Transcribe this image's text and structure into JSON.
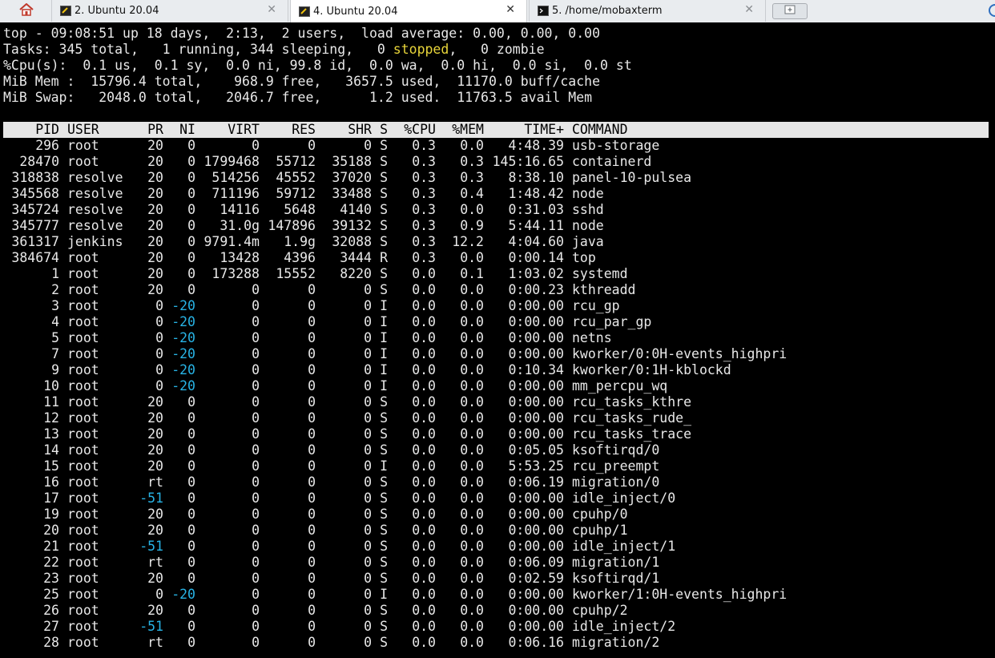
{
  "tabs": {
    "home_icon": "home-icon",
    "items": [
      {
        "label": "2. Ubuntu 20.04",
        "icon": "ssh-session-icon",
        "close": "✕"
      },
      {
        "label": "4. Ubuntu 20.04",
        "icon": "ssh-session-icon",
        "close": "✕"
      },
      {
        "label": "5. /home/mobaxterm",
        "icon": "terminal-icon",
        "close": "✕"
      }
    ],
    "new_tab_icon": "new-tab-icon"
  },
  "summary": {
    "line1": "top - 09:08:51 up 18 days,  2:13,  2 users,  load average: 0.00, 0.00, 0.00",
    "line2_pre": "Tasks: 345 total,   1 running, 344 sleeping,   0 ",
    "line2_stopped": "stopped",
    "line2_post": ",   0 zombie",
    "line3": "%Cpu(s):  0.1 us,  0.1 sy,  0.0 ni, 99.8 id,  0.0 wa,  0.0 hi,  0.0 si,  0.0 st",
    "line4": "MiB Mem :  15796.4 total,    968.9 free,   3657.5 used,  11170.0 buff/cache",
    "line5": "MiB Swap:   2048.0 total,   2046.7 free,      1.2 used.  11763.5 avail Mem"
  },
  "columns": [
    "PID",
    "USER",
    "PR",
    "NI",
    "VIRT",
    "RES",
    "SHR",
    "S",
    "%CPU",
    "%MEM",
    "TIME+",
    "COMMAND"
  ],
  "processes": [
    [
      "296",
      "root",
      "20",
      "0",
      "0",
      "0",
      "0",
      "S",
      "0.3",
      "0.0",
      "4:48.39",
      "usb-storage"
    ],
    [
      "28470",
      "root",
      "20",
      "0",
      "1799468",
      "55712",
      "35188",
      "S",
      "0.3",
      "0.3",
      "145:16.65",
      "containerd"
    ],
    [
      "318838",
      "resolve",
      "20",
      "0",
      "514256",
      "45552",
      "37020",
      "S",
      "0.3",
      "0.3",
      "8:38.10",
      "panel-10-pulsea"
    ],
    [
      "345568",
      "resolve",
      "20",
      "0",
      "711196",
      "59712",
      "33488",
      "S",
      "0.3",
      "0.4",
      "1:48.42",
      "node"
    ],
    [
      "345724",
      "resolve",
      "20",
      "0",
      "14116",
      "5648",
      "4140",
      "S",
      "0.3",
      "0.0",
      "0:31.03",
      "sshd"
    ],
    [
      "345777",
      "resolve",
      "20",
      "0",
      "31.0g",
      "147896",
      "39132",
      "S",
      "0.3",
      "0.9",
      "5:44.11",
      "node"
    ],
    [
      "361317",
      "jenkins",
      "20",
      "0",
      "9791.4m",
      "1.9g",
      "32088",
      "S",
      "0.3",
      "12.2",
      "4:04.60",
      "java"
    ],
    [
      "384674",
      "root",
      "20",
      "0",
      "13428",
      "4396",
      "3444",
      "R",
      "0.3",
      "0.0",
      "0:00.14",
      "top"
    ],
    [
      "1",
      "root",
      "20",
      "0",
      "173288",
      "15552",
      "8220",
      "S",
      "0.0",
      "0.1",
      "1:03.02",
      "systemd"
    ],
    [
      "2",
      "root",
      "20",
      "0",
      "0",
      "0",
      "0",
      "S",
      "0.0",
      "0.0",
      "0:00.23",
      "kthreadd"
    ],
    [
      "3",
      "root",
      "0",
      "-20",
      "0",
      "0",
      "0",
      "I",
      "0.0",
      "0.0",
      "0:00.00",
      "rcu_gp"
    ],
    [
      "4",
      "root",
      "0",
      "-20",
      "0",
      "0",
      "0",
      "I",
      "0.0",
      "0.0",
      "0:00.00",
      "rcu_par_gp"
    ],
    [
      "5",
      "root",
      "0",
      "-20",
      "0",
      "0",
      "0",
      "I",
      "0.0",
      "0.0",
      "0:00.00",
      "netns"
    ],
    [
      "7",
      "root",
      "0",
      "-20",
      "0",
      "0",
      "0",
      "I",
      "0.0",
      "0.0",
      "0:00.00",
      "kworker/0:0H-events_highpri"
    ],
    [
      "9",
      "root",
      "0",
      "-20",
      "0",
      "0",
      "0",
      "I",
      "0.0",
      "0.0",
      "0:10.34",
      "kworker/0:1H-kblockd"
    ],
    [
      "10",
      "root",
      "0",
      "-20",
      "0",
      "0",
      "0",
      "I",
      "0.0",
      "0.0",
      "0:00.00",
      "mm_percpu_wq"
    ],
    [
      "11",
      "root",
      "20",
      "0",
      "0",
      "0",
      "0",
      "S",
      "0.0",
      "0.0",
      "0:00.00",
      "rcu_tasks_kthre"
    ],
    [
      "12",
      "root",
      "20",
      "0",
      "0",
      "0",
      "0",
      "S",
      "0.0",
      "0.0",
      "0:00.00",
      "rcu_tasks_rude_"
    ],
    [
      "13",
      "root",
      "20",
      "0",
      "0",
      "0",
      "0",
      "S",
      "0.0",
      "0.0",
      "0:00.00",
      "rcu_tasks_trace"
    ],
    [
      "14",
      "root",
      "20",
      "0",
      "0",
      "0",
      "0",
      "S",
      "0.0",
      "0.0",
      "0:05.05",
      "ksoftirqd/0"
    ],
    [
      "15",
      "root",
      "20",
      "0",
      "0",
      "0",
      "0",
      "I",
      "0.0",
      "0.0",
      "5:53.25",
      "rcu_preempt"
    ],
    [
      "16",
      "root",
      "rt",
      "0",
      "0",
      "0",
      "0",
      "S",
      "0.0",
      "0.0",
      "0:06.19",
      "migration/0"
    ],
    [
      "17",
      "root",
      "-51",
      "0",
      "0",
      "0",
      "0",
      "S",
      "0.0",
      "0.0",
      "0:00.00",
      "idle_inject/0"
    ],
    [
      "19",
      "root",
      "20",
      "0",
      "0",
      "0",
      "0",
      "S",
      "0.0",
      "0.0",
      "0:00.00",
      "cpuhp/0"
    ],
    [
      "20",
      "root",
      "20",
      "0",
      "0",
      "0",
      "0",
      "S",
      "0.0",
      "0.0",
      "0:00.00",
      "cpuhp/1"
    ],
    [
      "21",
      "root",
      "-51",
      "0",
      "0",
      "0",
      "0",
      "S",
      "0.0",
      "0.0",
      "0:00.00",
      "idle_inject/1"
    ],
    [
      "22",
      "root",
      "rt",
      "0",
      "0",
      "0",
      "0",
      "S",
      "0.0",
      "0.0",
      "0:06.09",
      "migration/1"
    ],
    [
      "23",
      "root",
      "20",
      "0",
      "0",
      "0",
      "0",
      "S",
      "0.0",
      "0.0",
      "0:02.59",
      "ksoftirqd/1"
    ],
    [
      "25",
      "root",
      "0",
      "-20",
      "0",
      "0",
      "0",
      "I",
      "0.0",
      "0.0",
      "0:00.00",
      "kworker/1:0H-events_highpri"
    ],
    [
      "26",
      "root",
      "20",
      "0",
      "0",
      "0",
      "0",
      "S",
      "0.0",
      "0.0",
      "0:00.00",
      "cpuhp/2"
    ],
    [
      "27",
      "root",
      "-51",
      "0",
      "0",
      "0",
      "0",
      "S",
      "0.0",
      "0.0",
      "0:00.00",
      "idle_inject/2"
    ],
    [
      "28",
      "root",
      "rt",
      "0",
      "0",
      "0",
      "0",
      "S",
      "0.0",
      "0.0",
      "0:06.16",
      "migration/2"
    ]
  ],
  "colors": {
    "terminal_bg": "#000000",
    "terminal_fg": "#e8e8e8",
    "header_bg": "#e6e6e6",
    "stopped": "#e8d53a",
    "negative_priority": "#28b4e6"
  }
}
